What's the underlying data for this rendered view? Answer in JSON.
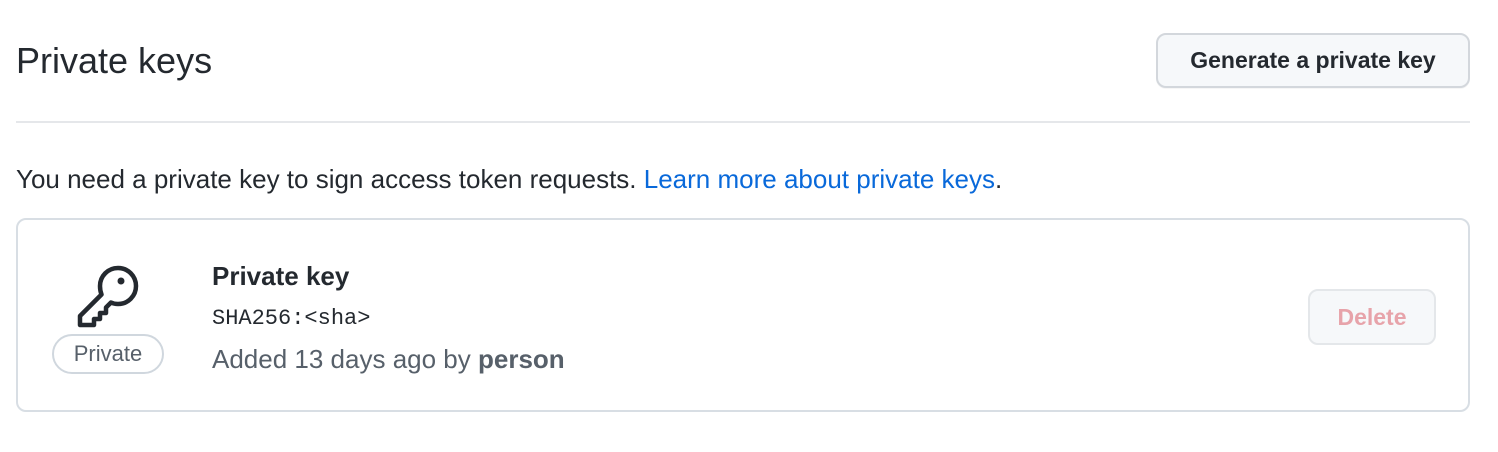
{
  "header": {
    "title": "Private keys",
    "generate_button_label": "Generate a private key"
  },
  "intro": {
    "text": "You need a private key to sign access token requests. ",
    "link_text": "Learn more about private keys",
    "trailing": "."
  },
  "key_card": {
    "icon": "key-icon",
    "badge_label": "Private",
    "title": "Private key",
    "sha": "SHA256:<sha>",
    "added_text": "Added 13 days ago by ",
    "added_by": "person",
    "delete_label": "Delete"
  },
  "colors": {
    "link": "#0969da",
    "danger_disabled": "#e7a3aa",
    "muted_text": "#57606a",
    "primary_text": "#24292f"
  }
}
